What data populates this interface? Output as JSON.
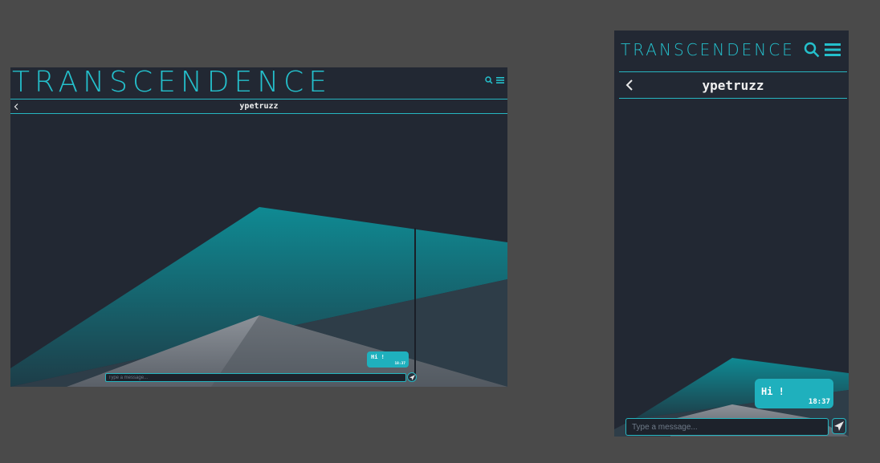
{
  "app": {
    "title": "TRANSCENDENCE"
  },
  "chat": {
    "contact": "ypetruzz",
    "messages": [
      {
        "text": "Hi !",
        "time": "18:37"
      }
    ],
    "input_placeholder": "Type a message..."
  },
  "icons": {
    "search": "search-icon",
    "menu": "hamburger-menu-icon",
    "back": "chevron-left-icon",
    "send": "paper-plane-icon"
  },
  "colors": {
    "accent": "#24c0cc",
    "background": "#222833",
    "page": "#4a4a4a",
    "bubble": "#1fb0bd"
  }
}
